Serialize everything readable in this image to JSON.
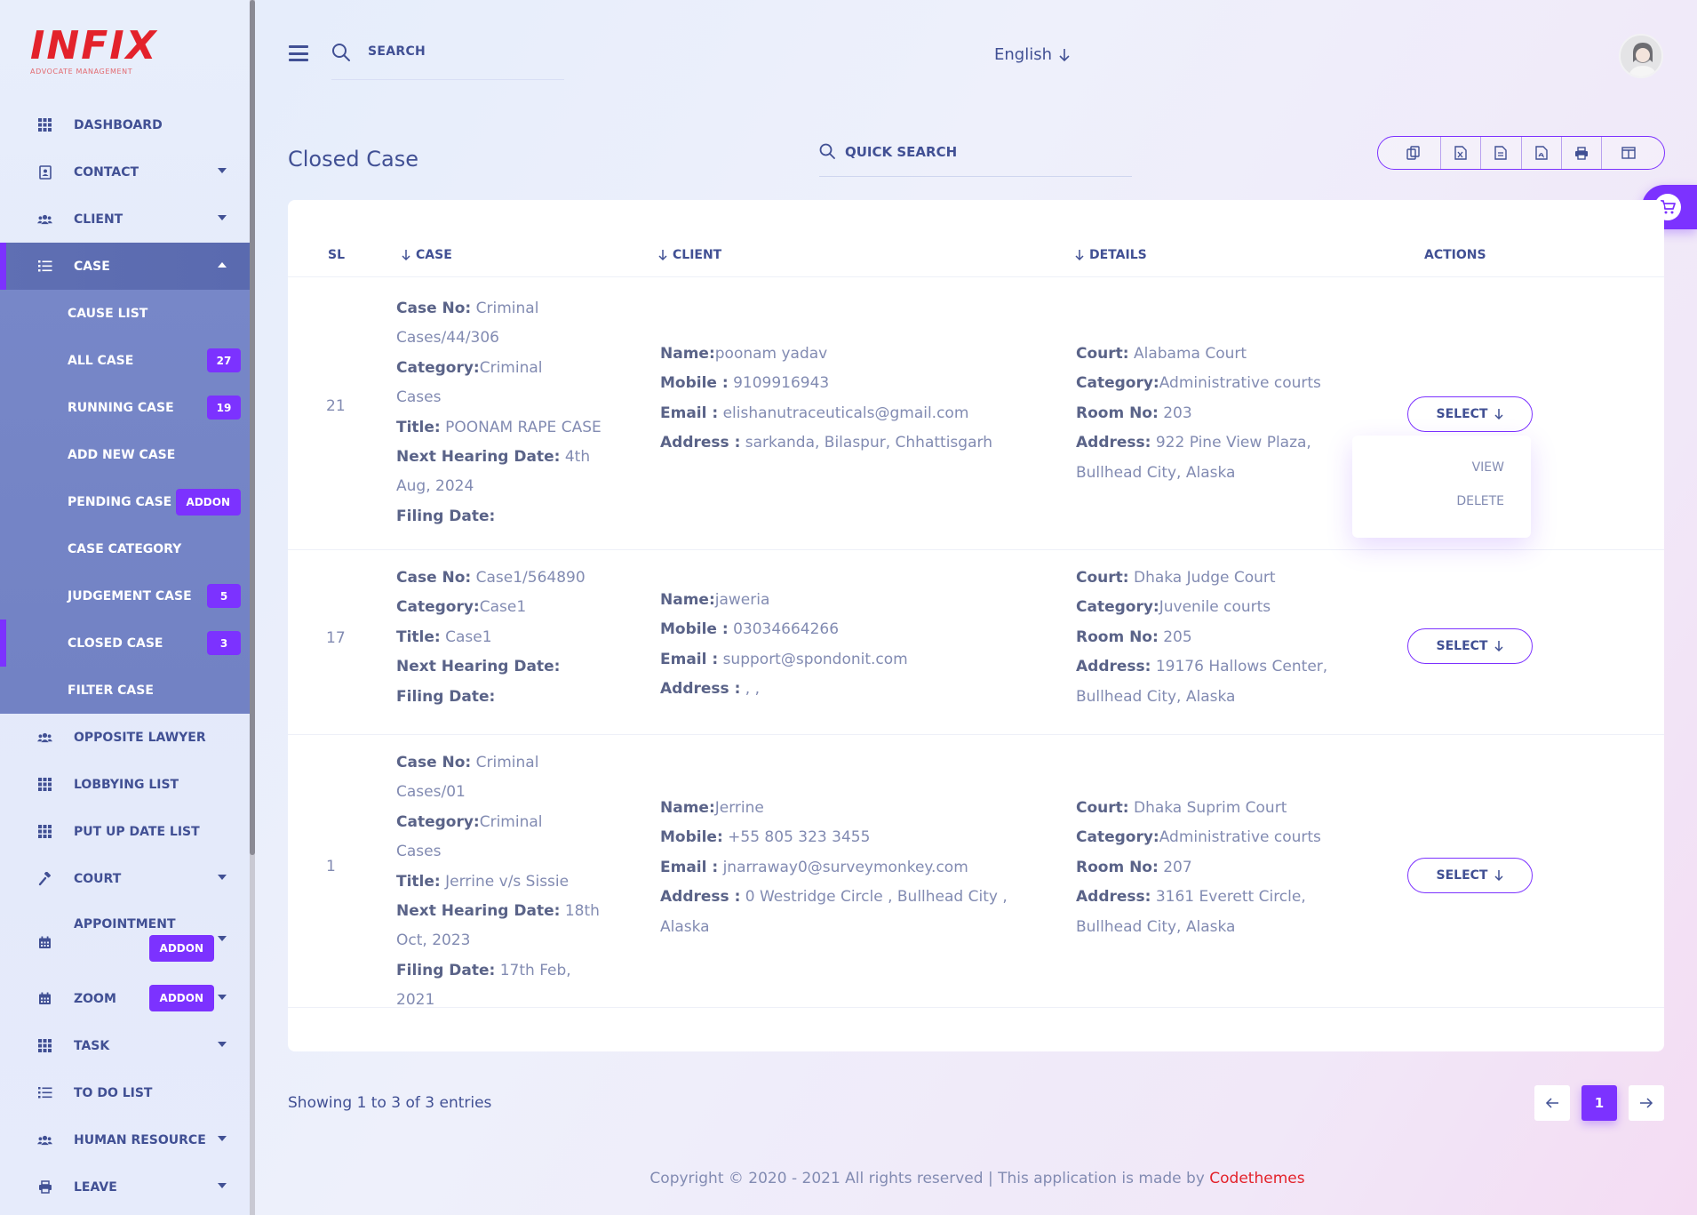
{
  "logo": {
    "mark": "INFIX",
    "sub": "ADVOCATE MANAGEMENT"
  },
  "topbar": {
    "search_label": "SEARCH",
    "language": "English"
  },
  "sidebar": {
    "items_top": [
      {
        "label": "DASHBOARD",
        "icon": "grid-icon",
        "caret": false
      },
      {
        "label": "CONTACT",
        "icon": "contact-book-icon",
        "caret": true
      },
      {
        "label": "CLIENT",
        "icon": "users-icon",
        "caret": true
      }
    ],
    "case": {
      "label": "CASE",
      "icon": "list-icon"
    },
    "case_sub": [
      {
        "label": "CAUSE LIST",
        "badge": ""
      },
      {
        "label": "ALL CASE",
        "badge": "27"
      },
      {
        "label": "RUNNING CASE",
        "badge": "19"
      },
      {
        "label": "ADD NEW CASE",
        "badge": ""
      },
      {
        "label": "PENDING CASE",
        "badge": "",
        "addon": "ADDON"
      },
      {
        "label": "CASE CATEGORY",
        "badge": ""
      },
      {
        "label": "JUDGEMENT CASE",
        "badge": "5"
      },
      {
        "label": "CLOSED CASE",
        "badge": "3"
      },
      {
        "label": "FILTER CASE",
        "badge": ""
      }
    ],
    "items_bottom": [
      {
        "label": "OPPOSITE LAWYER",
        "icon": "users-icon",
        "caret": false
      },
      {
        "label": "LOBBYING LIST",
        "icon": "grid-icon",
        "caret": false
      },
      {
        "label": "PUT UP DATE LIST",
        "icon": "grid-icon",
        "caret": false
      },
      {
        "label": "COURT",
        "icon": "gavel-icon",
        "caret": true
      },
      {
        "label": "APPOINTMENT",
        "icon": "calendar-icon",
        "caret": true,
        "addon": "ADDON"
      },
      {
        "label": "ZOOM",
        "icon": "calendar-icon",
        "caret": true,
        "addon": "ADDON"
      },
      {
        "label": "TASK",
        "icon": "grid-icon",
        "caret": true
      },
      {
        "label": "TO DO LIST",
        "icon": "list-icon",
        "caret": false
      },
      {
        "label": "HUMAN RESOURCE",
        "icon": "users-icon",
        "caret": true
      },
      {
        "label": "LEAVE",
        "icon": "printer-icon",
        "caret": true
      }
    ]
  },
  "page": {
    "title": "Closed Case",
    "quick_search": "QUICK SEARCH",
    "export_buttons": [
      "copy-icon",
      "excel-icon",
      "csv-icon",
      "pdf-icon",
      "print-icon",
      "columns-icon"
    ]
  },
  "table": {
    "headers": {
      "sl": "SL",
      "case": "CASE",
      "client": "CLIENT",
      "details": "DETAILS",
      "actions": "ACTIONS"
    },
    "select_label": "SELECT",
    "dropdown": {
      "view": "VIEW",
      "delete": "DELETE"
    },
    "rows": [
      {
        "sl": "21",
        "case_lines": [
          [
            "Case No:",
            " Criminal"
          ],
          [
            "",
            "Cases/44/306"
          ],
          [
            "Category:",
            "Criminal"
          ],
          [
            "",
            "Cases"
          ],
          [
            "Title:",
            " POONAM RAPE CASE"
          ],
          [
            "Next Hearing Date:",
            " 4th"
          ],
          [
            "",
            "Aug, 2024"
          ],
          [
            "Filing Date:",
            ""
          ]
        ],
        "client_lines": [
          [
            "Name:",
            "poonam yadav"
          ],
          [
            "Mobile :",
            " 9109916943"
          ],
          [
            "Email :",
            " elishanutraceuticals@gmail.com"
          ],
          [
            "Address :",
            " sarkanda, Bilaspur, Chhattisgarh"
          ]
        ],
        "details_lines": [
          [
            "Court:",
            " Alabama Court"
          ],
          [
            "Category:",
            "Administrative courts"
          ],
          [
            "Room No:",
            " 203"
          ],
          [
            "Address:",
            " 922 Pine View Plaza,"
          ],
          [
            "",
            "Bullhead City, Alaska"
          ]
        ]
      },
      {
        "sl": "17",
        "case_lines": [
          [
            "Case No:",
            " Case1/564890"
          ],
          [
            "Category:",
            "Case1"
          ],
          [
            "Title:",
            " Case1"
          ],
          [
            "Next Hearing Date:",
            ""
          ],
          [
            "Filing Date:",
            ""
          ]
        ],
        "client_lines": [
          [
            "Name:",
            "jaweria"
          ],
          [
            "Mobile :",
            " 03034664266"
          ],
          [
            "Email :",
            " support@spondonit.com"
          ],
          [
            "Address :",
            " , ,"
          ]
        ],
        "details_lines": [
          [
            "Court:",
            " Dhaka Judge Court"
          ],
          [
            "Category:",
            "Juvenile courts"
          ],
          [
            "Room No:",
            " 205"
          ],
          [
            "Address:",
            " 19176 Hallows Center,"
          ],
          [
            "",
            "Bullhead City, Alaska"
          ]
        ]
      },
      {
        "sl": "1",
        "case_lines": [
          [
            "Case No:",
            " Criminal"
          ],
          [
            "",
            "Cases/01"
          ],
          [
            "Category:",
            "Criminal"
          ],
          [
            "",
            "Cases"
          ],
          [
            "Title:",
            " Jerrine v/s Sissie"
          ],
          [
            "Next Hearing Date:",
            " 18th"
          ],
          [
            "",
            "Oct, 2023"
          ],
          [
            "Filing Date:",
            " 17th Feb, 2021"
          ]
        ],
        "client_lines": [
          [
            "Name:",
            "Jerrine"
          ],
          [
            "Mobile:",
            " +55 805 323 3455"
          ],
          [
            "Email :",
            " jnarraway0@surveymonkey.com"
          ],
          [
            "Address :",
            " 0 Westridge Circle , Bullhead City ,"
          ],
          [
            "",
            "Alaska"
          ]
        ],
        "details_lines": [
          [
            "Court:",
            " Dhaka Suprim Court"
          ],
          [
            "Category:",
            "Administrative courts"
          ],
          [
            "Room No:",
            " 207"
          ],
          [
            "Address:",
            " 3161 Everett Circle,"
          ],
          [
            "",
            "Bullhead City, Alaska"
          ]
        ]
      }
    ]
  },
  "footer": {
    "showing": "Showing 1 to 3 of 3 entries",
    "current_page": "1",
    "copyright": "Copyright © 2020 - 2021 All rights reserved | This application is made by ",
    "brand": "Codethemes"
  },
  "colors": {
    "accent": "#7c32ff",
    "text": "#415094",
    "muted": "#828bb2",
    "brand_red": "#e3222b"
  }
}
